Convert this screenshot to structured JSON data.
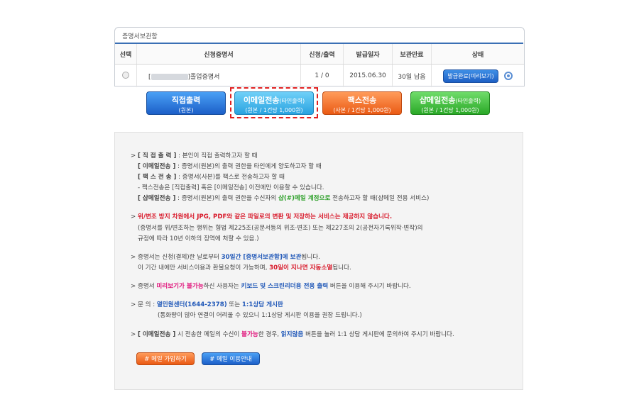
{
  "tab": {
    "title": "증명서보관함"
  },
  "table": {
    "headers": [
      "선택",
      "신청증명서",
      "신청/출력",
      "발급일자",
      "보관만료",
      "상태"
    ],
    "row": {
      "cert_prefix": "[",
      "cert_suffix": "]졸업증명서",
      "count": "1 / 0",
      "issue_date": "2015.06.30",
      "expiry": "30일 남음",
      "status_button": "발급완료(미리보기)"
    }
  },
  "buttons": {
    "direct": {
      "title": "직접출력",
      "sub": "(원본)"
    },
    "email": {
      "title": "이메일전송",
      "note": "(타인출력)",
      "sub": "(원본 / 1건당 1,000원)"
    },
    "fax": {
      "title": "팩스전송",
      "sub": "(사본 / 1건당 1,000원)"
    },
    "shap": {
      "title": "샵메일전송",
      "note": "(타인출력)",
      "sub": "(원본 / 1건당 1,000원)"
    }
  },
  "info": {
    "l1": {
      "a": "> ",
      "b": "[ 직 접 출 력 ]",
      "c": " : 본인이 직접 출력하고자 할 때"
    },
    "l2": {
      "b": "[ 이메일전송 ]",
      "c": " : 증명서(원본)의 출력 권한을 타인에게 양도하고자 할 때"
    },
    "l3": {
      "b": "[ 팩 스 전 송 ]",
      "c": " : 증명서(사본)를 팩스로 전송하고자 할 때"
    },
    "l4": {
      "c": "- 팩스전송은 [직접출력] 혹은 [이메일전송] 이전에만 이용할 수 있습니다."
    },
    "l5": {
      "b": "[ 샵메일전송 ]",
      "c": " : 증명서(원본)의 출력 권한을 수신자의 ",
      "g": "샵(#)메일 계정으로",
      "d": " 전송하고자 할 때(샵메일 전용 서비스)"
    },
    "l6": {
      "a": "> ",
      "r": "위/변조 방지 차원에서 JPG, PDF와 같은 파일로의 변환 및 저장하는 서비스는 제공하지 않습니다."
    },
    "l7": {
      "c": "(증명서를 위/변조하는 행위는 형법 제225조(공문서등의 위조·변조) 또는 제227조의 2(공전자기록위작·변작)의"
    },
    "l8": {
      "c": "규정에 따라 10년 이하의 징역에 처할 수 있음.)"
    },
    "l9": {
      "a": "> ",
      "c": "증명서는 신청(결제)한 날로부터 ",
      "bl": "30일간 [증명서보관함]에 보관",
      "d": "됩니다."
    },
    "l10": {
      "c": "이 기간 내에만 서비스이용과 환불요청이 가능하며, ",
      "r": "30일이 지나면 자동소멸",
      "d": "됩니다."
    },
    "l11": {
      "a": "> ",
      "c": "증명서 ",
      "p": "미리보기가 불가능",
      "d": "하신 사용자는 ",
      "bl": "키보드 및 스크린리더용 전용 출력",
      "e": " 버튼을 이용해 주시기 바랍니다."
    },
    "l12": {
      "a": "> ",
      "c": "문 의 : ",
      "bl": "열민원센터(1644-2378)",
      "d": " 또는 ",
      "bl2": "1:1상담 게시판"
    },
    "l13": {
      "c": "(통화량이 많아 연결이 어려울 수 있으니 1:1상담 게시판 이용을 권장 드립니다.)"
    },
    "l14": {
      "a": "> ",
      "b": "[ 이메일전송 ]",
      "c": " 시 전송한 메일의 수신이 ",
      "p": "불가능",
      "d": "한 경우, ",
      "bl": "읽지않음",
      "e": " 버튼을 눌러 1:1 상담 게시판에 문의하여 주시기 바랍니다."
    }
  },
  "small_buttons": {
    "join": "# 메일 가입하기",
    "guide": "# 메일 이용안내"
  }
}
